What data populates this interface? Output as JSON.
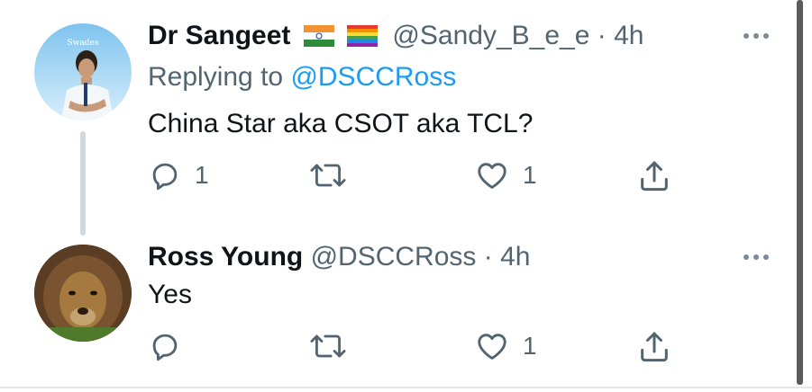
{
  "tweets": [
    {
      "name": "Dr Sangeet",
      "flags": [
        "india-flag-icon",
        "rainbow-flag-icon"
      ],
      "handle": "@Sandy_B_e_e",
      "separator": "·",
      "time": "4h",
      "replying_prefix": "Replying to",
      "replying_to": "@DSCCRoss",
      "avatar_caption": "Swades",
      "text": "China Star aka CSOT aka TCL?",
      "reply_count": "1",
      "retweet_count": "",
      "like_count": "1"
    },
    {
      "name": "Ross Young",
      "handle": "@DSCCRoss",
      "separator": "·",
      "time": "4h",
      "text": "Yes",
      "reply_count": "",
      "retweet_count": "",
      "like_count": "1"
    }
  ],
  "icons": {
    "reply": "reply-icon",
    "retweet": "retweet-icon",
    "like": "like-icon",
    "share": "share-icon",
    "more": "more-icon"
  },
  "colors": {
    "text": "#0f1419",
    "secondary": "#536471",
    "link": "#1d9bf0",
    "thread_line": "#cfd9de"
  }
}
